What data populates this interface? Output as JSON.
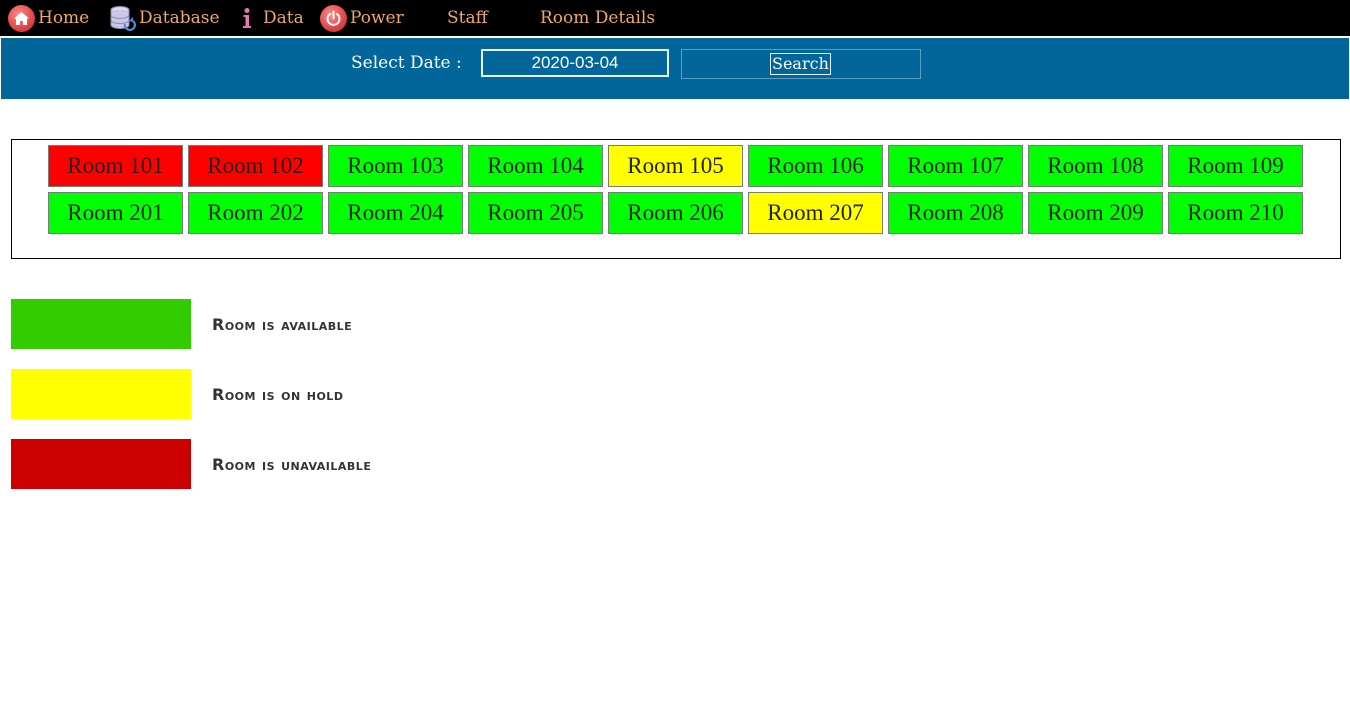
{
  "nav": {
    "items": [
      {
        "label": "Home",
        "icon": "home-icon"
      },
      {
        "label": "Database",
        "icon": "database-icon"
      },
      {
        "label": "Data",
        "icon": "info-icon"
      },
      {
        "label": "Power",
        "icon": "power-icon"
      },
      {
        "label": "Staff",
        "icon": ""
      },
      {
        "label": "Room Details",
        "icon": ""
      }
    ]
  },
  "search": {
    "date_label": "Select Date :",
    "date_value": "2020-03-04",
    "button_label": "Search"
  },
  "rooms": {
    "row1": [
      {
        "label": "Room 101",
        "status": "unavailable"
      },
      {
        "label": "Room 102",
        "status": "unavailable"
      },
      {
        "label": "Room 103",
        "status": "available"
      },
      {
        "label": "Room 104",
        "status": "available"
      },
      {
        "label": "Room 105",
        "status": "on-hold"
      },
      {
        "label": "Room 106",
        "status": "available"
      },
      {
        "label": "Room 107",
        "status": "available"
      },
      {
        "label": "Room 108",
        "status": "available"
      },
      {
        "label": "Room 109",
        "status": "available"
      }
    ],
    "row2": [
      {
        "label": "Room 201",
        "status": "available"
      },
      {
        "label": "Room 202",
        "status": "available"
      },
      {
        "label": "Room 204",
        "status": "available"
      },
      {
        "label": "Room 205",
        "status": "available"
      },
      {
        "label": "Room 206",
        "status": "available"
      },
      {
        "label": "Room 207",
        "status": "on-hold"
      },
      {
        "label": "Room 208",
        "status": "available"
      },
      {
        "label": "Room 209",
        "status": "available"
      },
      {
        "label": "Room 210",
        "status": "available"
      }
    ]
  },
  "status_colors": {
    "available": "#00ff00",
    "on-hold": "#ffff00",
    "unavailable": "#ff0000"
  },
  "legend": [
    {
      "label": "Room is available",
      "color": "#33cc00"
    },
    {
      "label": "Room is on hold",
      "color": "#ffff00"
    },
    {
      "label": "Room is unavailable",
      "color": "#cc0000"
    }
  ]
}
